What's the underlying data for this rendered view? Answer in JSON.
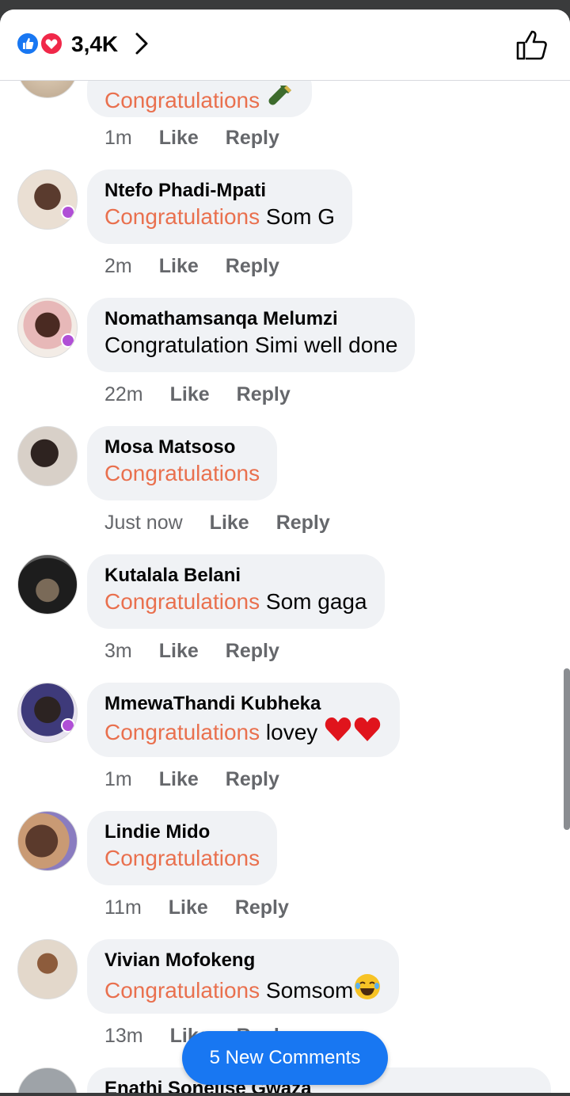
{
  "header": {
    "reaction_count": "3,4K",
    "icons": [
      "like-reaction-icon",
      "love-reaction-icon",
      "chevron-right-icon",
      "thumbs-up-icon"
    ],
    "colors": {
      "like_blue": "#1877f2",
      "love_red": "#f02849"
    }
  },
  "comments": [
    {
      "name": "",
      "prefix": "Congratulations",
      "rest": "",
      "emoji": "bottle-emoji",
      "time": "1m",
      "like": "Like",
      "reply": "Reply"
    },
    {
      "name": "Ntefo Phadi-Mpati",
      "prefix": "Congratulations",
      "rest": " Som G",
      "time": "2m",
      "like": "Like",
      "reply": "Reply"
    },
    {
      "name": "Nomathamsanqa Melumzi",
      "prefix": "",
      "rest": "Congratulation Simi well done",
      "time": "22m",
      "like": "Like",
      "reply": "Reply"
    },
    {
      "name": "Mosa Matsoso",
      "prefix": "Congratulations",
      "rest": "",
      "time": "Just now",
      "like": "Like",
      "reply": "Reply"
    },
    {
      "name": "Kutalala Belani",
      "prefix": "Congratulations",
      "rest": " Som gaga",
      "time": "3m",
      "like": "Like",
      "reply": "Reply"
    },
    {
      "name": "MmewaThandi Kubheka",
      "prefix": "Congratulations",
      "rest": " lovey ",
      "emoji": "two-hearts-emoji",
      "time": "1m",
      "like": "Like",
      "reply": "Reply"
    },
    {
      "name": "Lindie Mido",
      "prefix": "Congratulations",
      "rest": "",
      "time": "11m",
      "like": "Like",
      "reply": "Reply"
    },
    {
      "name": "Vivian Mofokeng",
      "prefix": "Congratulations",
      "rest": " Somsom",
      "emoji": "laughing-emoji",
      "time": "13m",
      "like": "Like",
      "reply": "Reply"
    },
    {
      "name": "Enathi Sonelise Gwaza"
    }
  ],
  "new_comments_button": "5 New Comments",
  "accent_color": "#e9704e"
}
